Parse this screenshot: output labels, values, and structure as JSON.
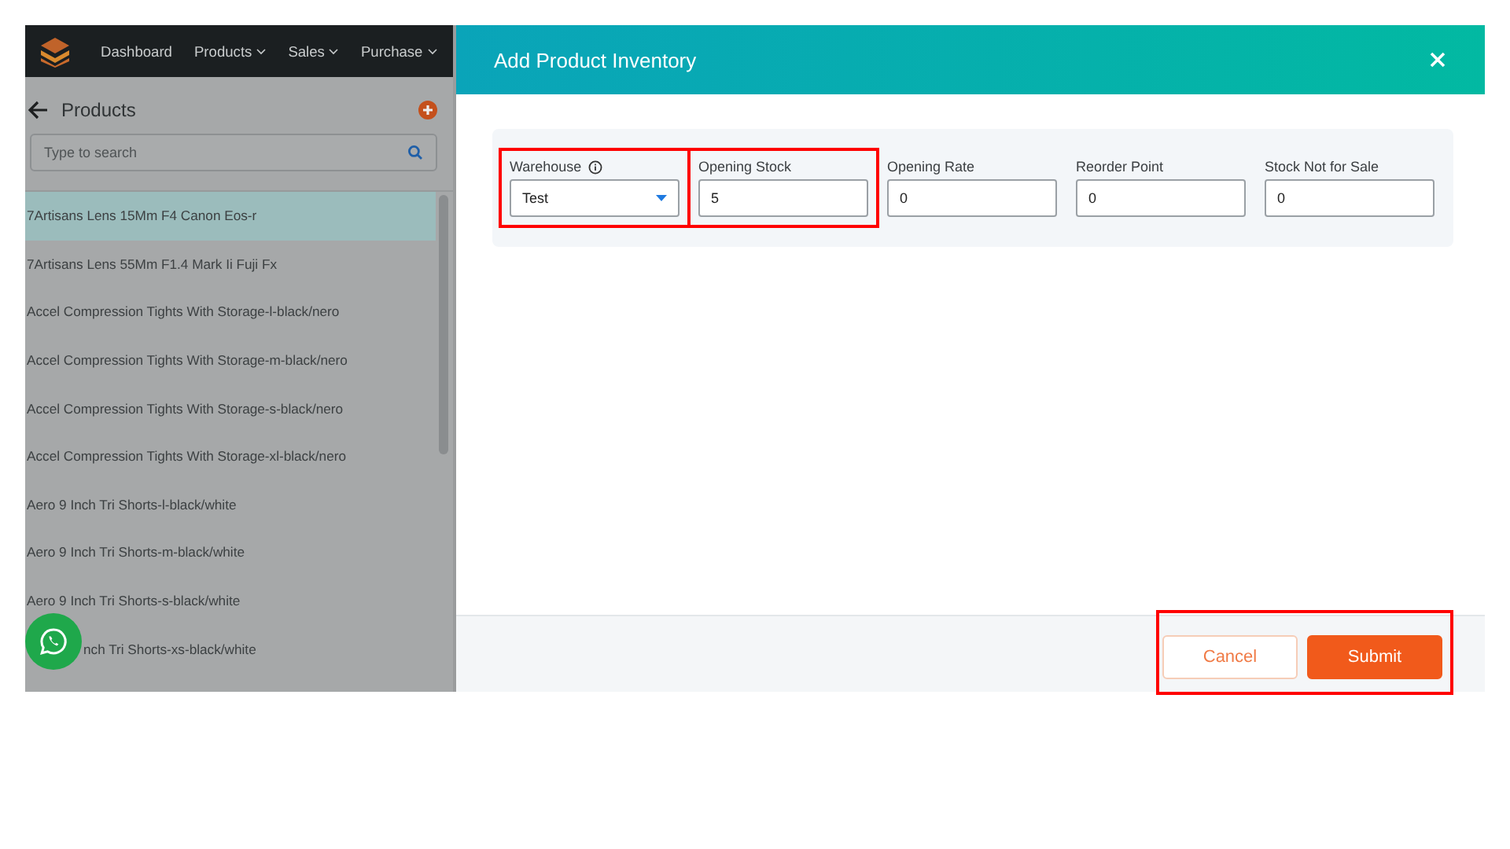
{
  "nav": {
    "items": [
      {
        "label": "Dashboard",
        "dropdown": false
      },
      {
        "label": "Products",
        "dropdown": true
      },
      {
        "label": "Sales",
        "dropdown": true
      },
      {
        "label": "Purchase",
        "dropdown": true
      }
    ]
  },
  "sidebar": {
    "title": "Products",
    "search": {
      "placeholder": "Type to search"
    },
    "items": [
      {
        "label": "7Artisans Lens 15Mm F4 Canon Eos-r",
        "selected": true
      },
      {
        "label": "7Artisans Lens 55Mm F1.4 Mark Ii Fuji Fx",
        "selected": false
      },
      {
        "label": "Accel Compression Tights With Storage-l-black/nero",
        "selected": false
      },
      {
        "label": "Accel Compression Tights With Storage-m-black/nero",
        "selected": false
      },
      {
        "label": "Accel Compression Tights With Storage-s-black/nero",
        "selected": false
      },
      {
        "label": "Accel Compression Tights With Storage-xl-black/nero",
        "selected": false
      },
      {
        "label": "Aero 9 Inch Tri Shorts-l-black/white",
        "selected": false
      },
      {
        "label": "Aero 9 Inch Tri Shorts-m-black/white",
        "selected": false
      },
      {
        "label": "Aero 9 Inch Tri Shorts-s-black/white",
        "selected": false
      },
      {
        "label": "nch Tri Shorts-xs-black/white",
        "selected": false,
        "covered": true
      }
    ]
  },
  "modal": {
    "title": "Add Product Inventory",
    "fields": [
      {
        "kind": "select",
        "label": "Warehouse",
        "info": true,
        "value": "Test",
        "highlighted": true
      },
      {
        "kind": "text",
        "label": "Opening Stock",
        "value": "5",
        "highlighted": true
      },
      {
        "kind": "text",
        "label": "Opening Rate",
        "value": "0",
        "highlighted": false
      },
      {
        "kind": "text",
        "label": "Reorder Point",
        "value": "0",
        "highlighted": false
      },
      {
        "kind": "text",
        "label": "Stock Not for Sale",
        "value": "0",
        "highlighted": false
      }
    ],
    "buttons": [
      {
        "label": "Cancel",
        "kind": "secondary"
      },
      {
        "label": "Submit",
        "kind": "primary"
      }
    ],
    "footer_highlighted": true
  }
}
